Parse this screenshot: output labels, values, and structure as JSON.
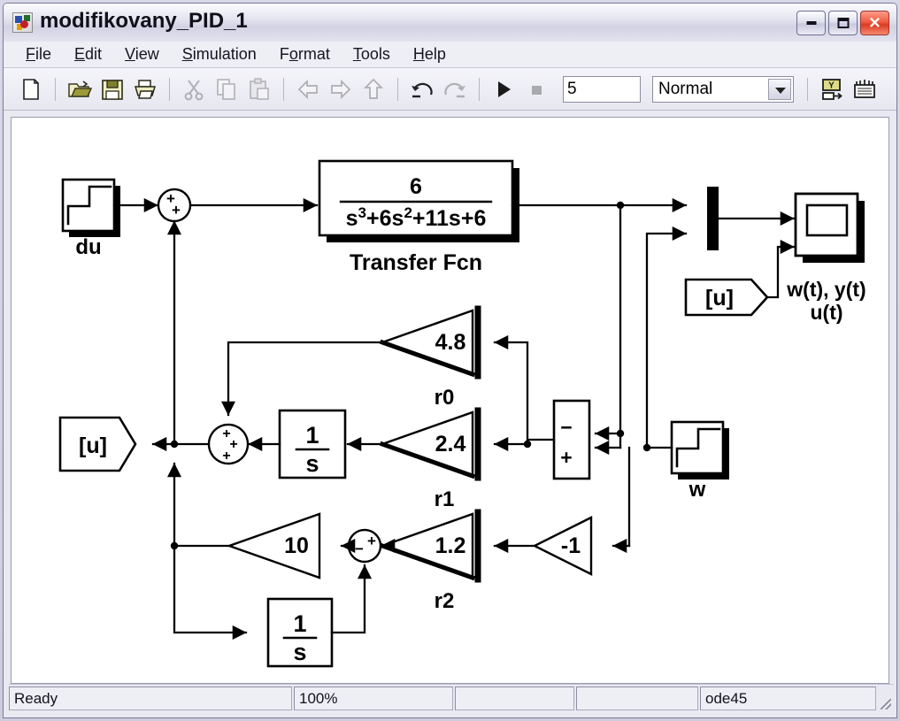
{
  "window": {
    "title": "modifikovany_PID_1",
    "icon": "simulink-model-icon",
    "minimize_label": "Minimize",
    "maximize_label": "Maximize",
    "close_label": "Close",
    "close_glyph": "✕"
  },
  "menu": {
    "items": [
      {
        "name": "file",
        "label": "File",
        "accel": "F"
      },
      {
        "name": "edit",
        "label": "Edit",
        "accel": "E"
      },
      {
        "name": "view",
        "label": "View",
        "accel": "V"
      },
      {
        "name": "simulation",
        "label": "Simulation",
        "accel": "S"
      },
      {
        "name": "format",
        "label": "Format",
        "accel": "o"
      },
      {
        "name": "tools",
        "label": "Tools",
        "accel": "T"
      },
      {
        "name": "help",
        "label": "Help",
        "accel": "H"
      }
    ]
  },
  "toolbar": {
    "buttons": [
      {
        "name": "new-model-button",
        "icon": "new-document-icon",
        "enabled": true
      },
      {
        "name": "open-model-button",
        "icon": "open-folder-icon",
        "enabled": true
      },
      {
        "name": "save-model-button",
        "icon": "floppy-save-icon",
        "enabled": true
      },
      {
        "name": "print-button",
        "icon": "printer-icon",
        "enabled": true
      },
      {
        "name": "cut-button",
        "icon": "scissors-icon",
        "enabled": false
      },
      {
        "name": "copy-button",
        "icon": "copy-icon",
        "enabled": false
      },
      {
        "name": "paste-button",
        "icon": "clipboard-paste-icon",
        "enabled": false
      },
      {
        "name": "back-button",
        "icon": "arrow-left-icon",
        "enabled": false
      },
      {
        "name": "forward-button",
        "icon": "arrow-right-icon",
        "enabled": false
      },
      {
        "name": "up-level-button",
        "icon": "arrow-up-icon",
        "enabled": false
      },
      {
        "name": "undo-button",
        "icon": "undo-icon",
        "enabled": false
      },
      {
        "name": "redo-button",
        "icon": "redo-icon",
        "enabled": false
      },
      {
        "name": "start-simulation-button",
        "icon": "play-icon",
        "enabled": true
      },
      {
        "name": "stop-simulation-button",
        "icon": "stop-square-icon",
        "enabled": false
      },
      {
        "name": "update-diagram-button",
        "icon": "signal-display-icon",
        "enabled": true
      },
      {
        "name": "debug-button",
        "icon": "debugger-icon",
        "enabled": true
      }
    ],
    "simulation_stop_time": "5",
    "simulation_mode": "Normal",
    "accent_olive": "#8a8a30"
  },
  "status_bar": {
    "message": "Ready",
    "zoom": "100%",
    "field3": "",
    "field4": "",
    "solver": "ode45"
  },
  "diagram": {
    "blocks": [
      {
        "name": "step-block-du",
        "type": "Step",
        "label": "du"
      },
      {
        "name": "sum-block-input",
        "type": "Sum",
        "signs": [
          "+",
          "+"
        ],
        "shape": "round"
      },
      {
        "name": "transfer-fcn-block",
        "type": "Transfer Fcn",
        "label": "Transfer Fcn",
        "numerator": "6",
        "denominator_html": "s<tspan baseline-shift=\"super\">3</tspan>+6s<tspan baseline-shift=\"super\">2</tspan>+11s+6",
        "numerator_text": "6",
        "denominator_text": "s3+6s2+11s+6"
      },
      {
        "name": "mux-block",
        "type": "Mux",
        "inputs": 2
      },
      {
        "name": "scope-block",
        "type": "Scope",
        "label_line1": "w(t), y(t)",
        "label_line2": "u(t)"
      },
      {
        "name": "from-block-u-scope",
        "type": "From",
        "tag": "[u]"
      },
      {
        "name": "goto-block-u",
        "type": "Goto",
        "tag": "[u]"
      },
      {
        "name": "gain-block-r0",
        "type": "Gain",
        "value": "4.8",
        "label": "r0"
      },
      {
        "name": "gain-block-r1",
        "type": "Gain",
        "value": "2.4",
        "label": "r1"
      },
      {
        "name": "gain-block-r2",
        "type": "Gain",
        "value": "1.2",
        "label": "r2"
      },
      {
        "name": "gain-block-10",
        "type": "Gain",
        "value": "10",
        "label": ""
      },
      {
        "name": "gain-block-minus1",
        "type": "Gain",
        "value": "-1",
        "label": ""
      },
      {
        "name": "sum-block-middle",
        "type": "Sum",
        "signs": [
          "+",
          "+",
          "+"
        ],
        "shape": "round"
      },
      {
        "name": "integrator-block-1",
        "type": "Integrator",
        "numerator": "1",
        "denominator": "s"
      },
      {
        "name": "integrator-block-2",
        "type": "Integrator",
        "numerator": "1",
        "denominator": "s"
      },
      {
        "name": "sum-block-bottom",
        "type": "Sum",
        "signs": [
          "+",
          "-"
        ],
        "shape": "round"
      },
      {
        "name": "sum-block-error",
        "type": "Sum",
        "signs": [
          "-",
          "+"
        ],
        "shape": "rect"
      },
      {
        "name": "step-block-w",
        "type": "Step",
        "label": "w"
      }
    ],
    "labels": {
      "du": "du",
      "w": "w",
      "transfer_fcn": "Transfer Fcn",
      "r0": "r0",
      "r1": "r1",
      "r2": "r2",
      "gain_48": "4.8",
      "gain_24": "2.4",
      "gain_12": "1.2",
      "gain_10": "10",
      "gain_m1": "-1",
      "tag_u": "[u]",
      "integ_num": "1",
      "integ_den": "s",
      "tf_num": "6",
      "scope_l1": "w(t), y(t)",
      "scope_l2": "u(t)",
      "sign_plus": "+",
      "sign_minus": "−"
    }
  }
}
